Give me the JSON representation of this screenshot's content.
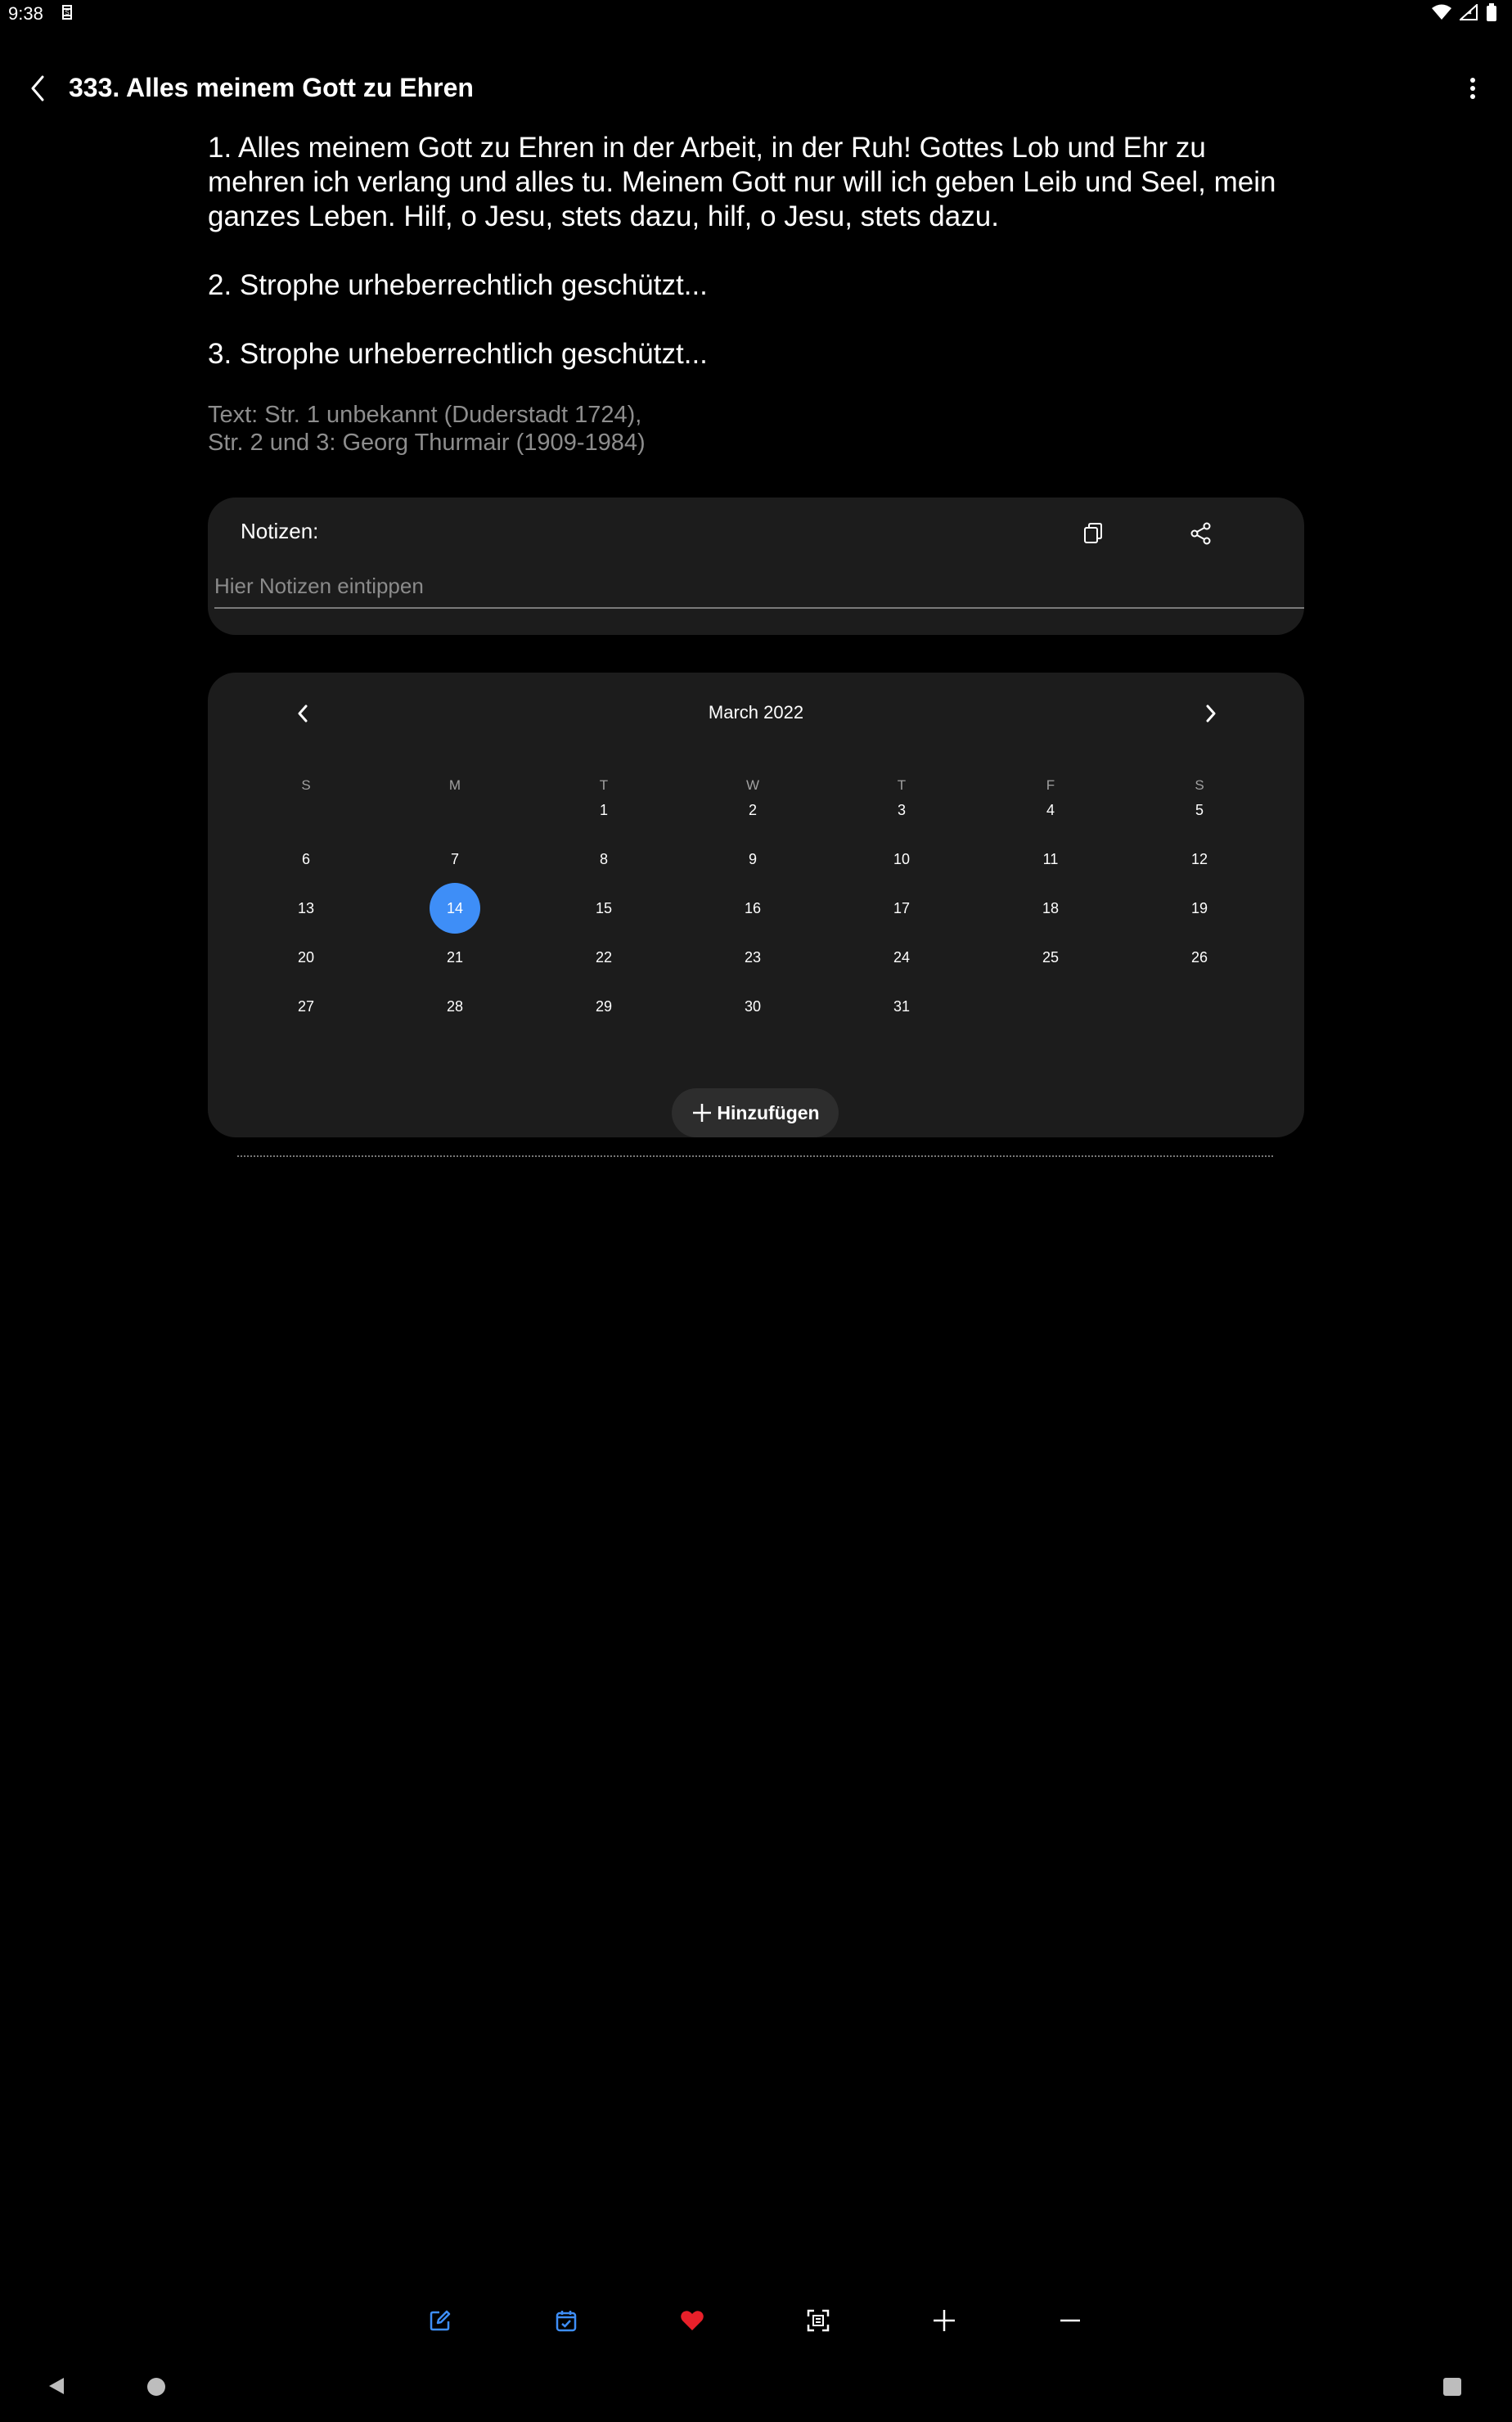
{
  "status_bar": {
    "time": "9:38"
  },
  "app_bar": {
    "title": "333. Alles meinem Gott zu Ehren"
  },
  "lyrics": {
    "verses": [
      "1. Alles meinem Gott zu Ehren in der Arbeit, in der Ruh! Gottes Lob und Ehr zu mehren ich verlang und alles tu. Meinem Gott nur will ich geben Leib und Seel, mein ganzes Leben. Hilf, o Jesu, stets dazu, hilf, o Jesu, stets dazu.",
      "2. Strophe urheberrechtlich geschützt...",
      "3. Strophe urheberrechtlich geschützt..."
    ],
    "credit_line1": "Text: Str. 1 unbekannt (Duderstadt 1724),",
    "credit_line2": "Str. 2 und 3: Georg Thurmair (1909-1984)"
  },
  "notes": {
    "label": "Notizen:",
    "placeholder": "Hier Notizen eintippen",
    "value": ""
  },
  "calendar": {
    "month_label": "March 2022",
    "weekdays": [
      "S",
      "M",
      "T",
      "W",
      "T",
      "F",
      "S"
    ],
    "weeks": [
      [
        "",
        "",
        "1",
        "2",
        "3",
        "4",
        "5"
      ],
      [
        "6",
        "7",
        "8",
        "9",
        "10",
        "11",
        "12"
      ],
      [
        "13",
        "14",
        "15",
        "16",
        "17",
        "18",
        "19"
      ],
      [
        "20",
        "21",
        "22",
        "23",
        "24",
        "25",
        "26"
      ],
      [
        "27",
        "28",
        "29",
        "30",
        "31",
        "",
        ""
      ]
    ],
    "selected_day": "14",
    "add_label": "Hinzufügen"
  },
  "toolbar": {
    "items": [
      "edit-icon",
      "calendar-check-icon",
      "heart-icon",
      "fullscreen-icon",
      "plus-icon",
      "minus-icon"
    ]
  },
  "colors": {
    "accent": "#3e8ef7",
    "heart": "#e8202a",
    "card": "#1c1c1c",
    "background": "#000000"
  }
}
